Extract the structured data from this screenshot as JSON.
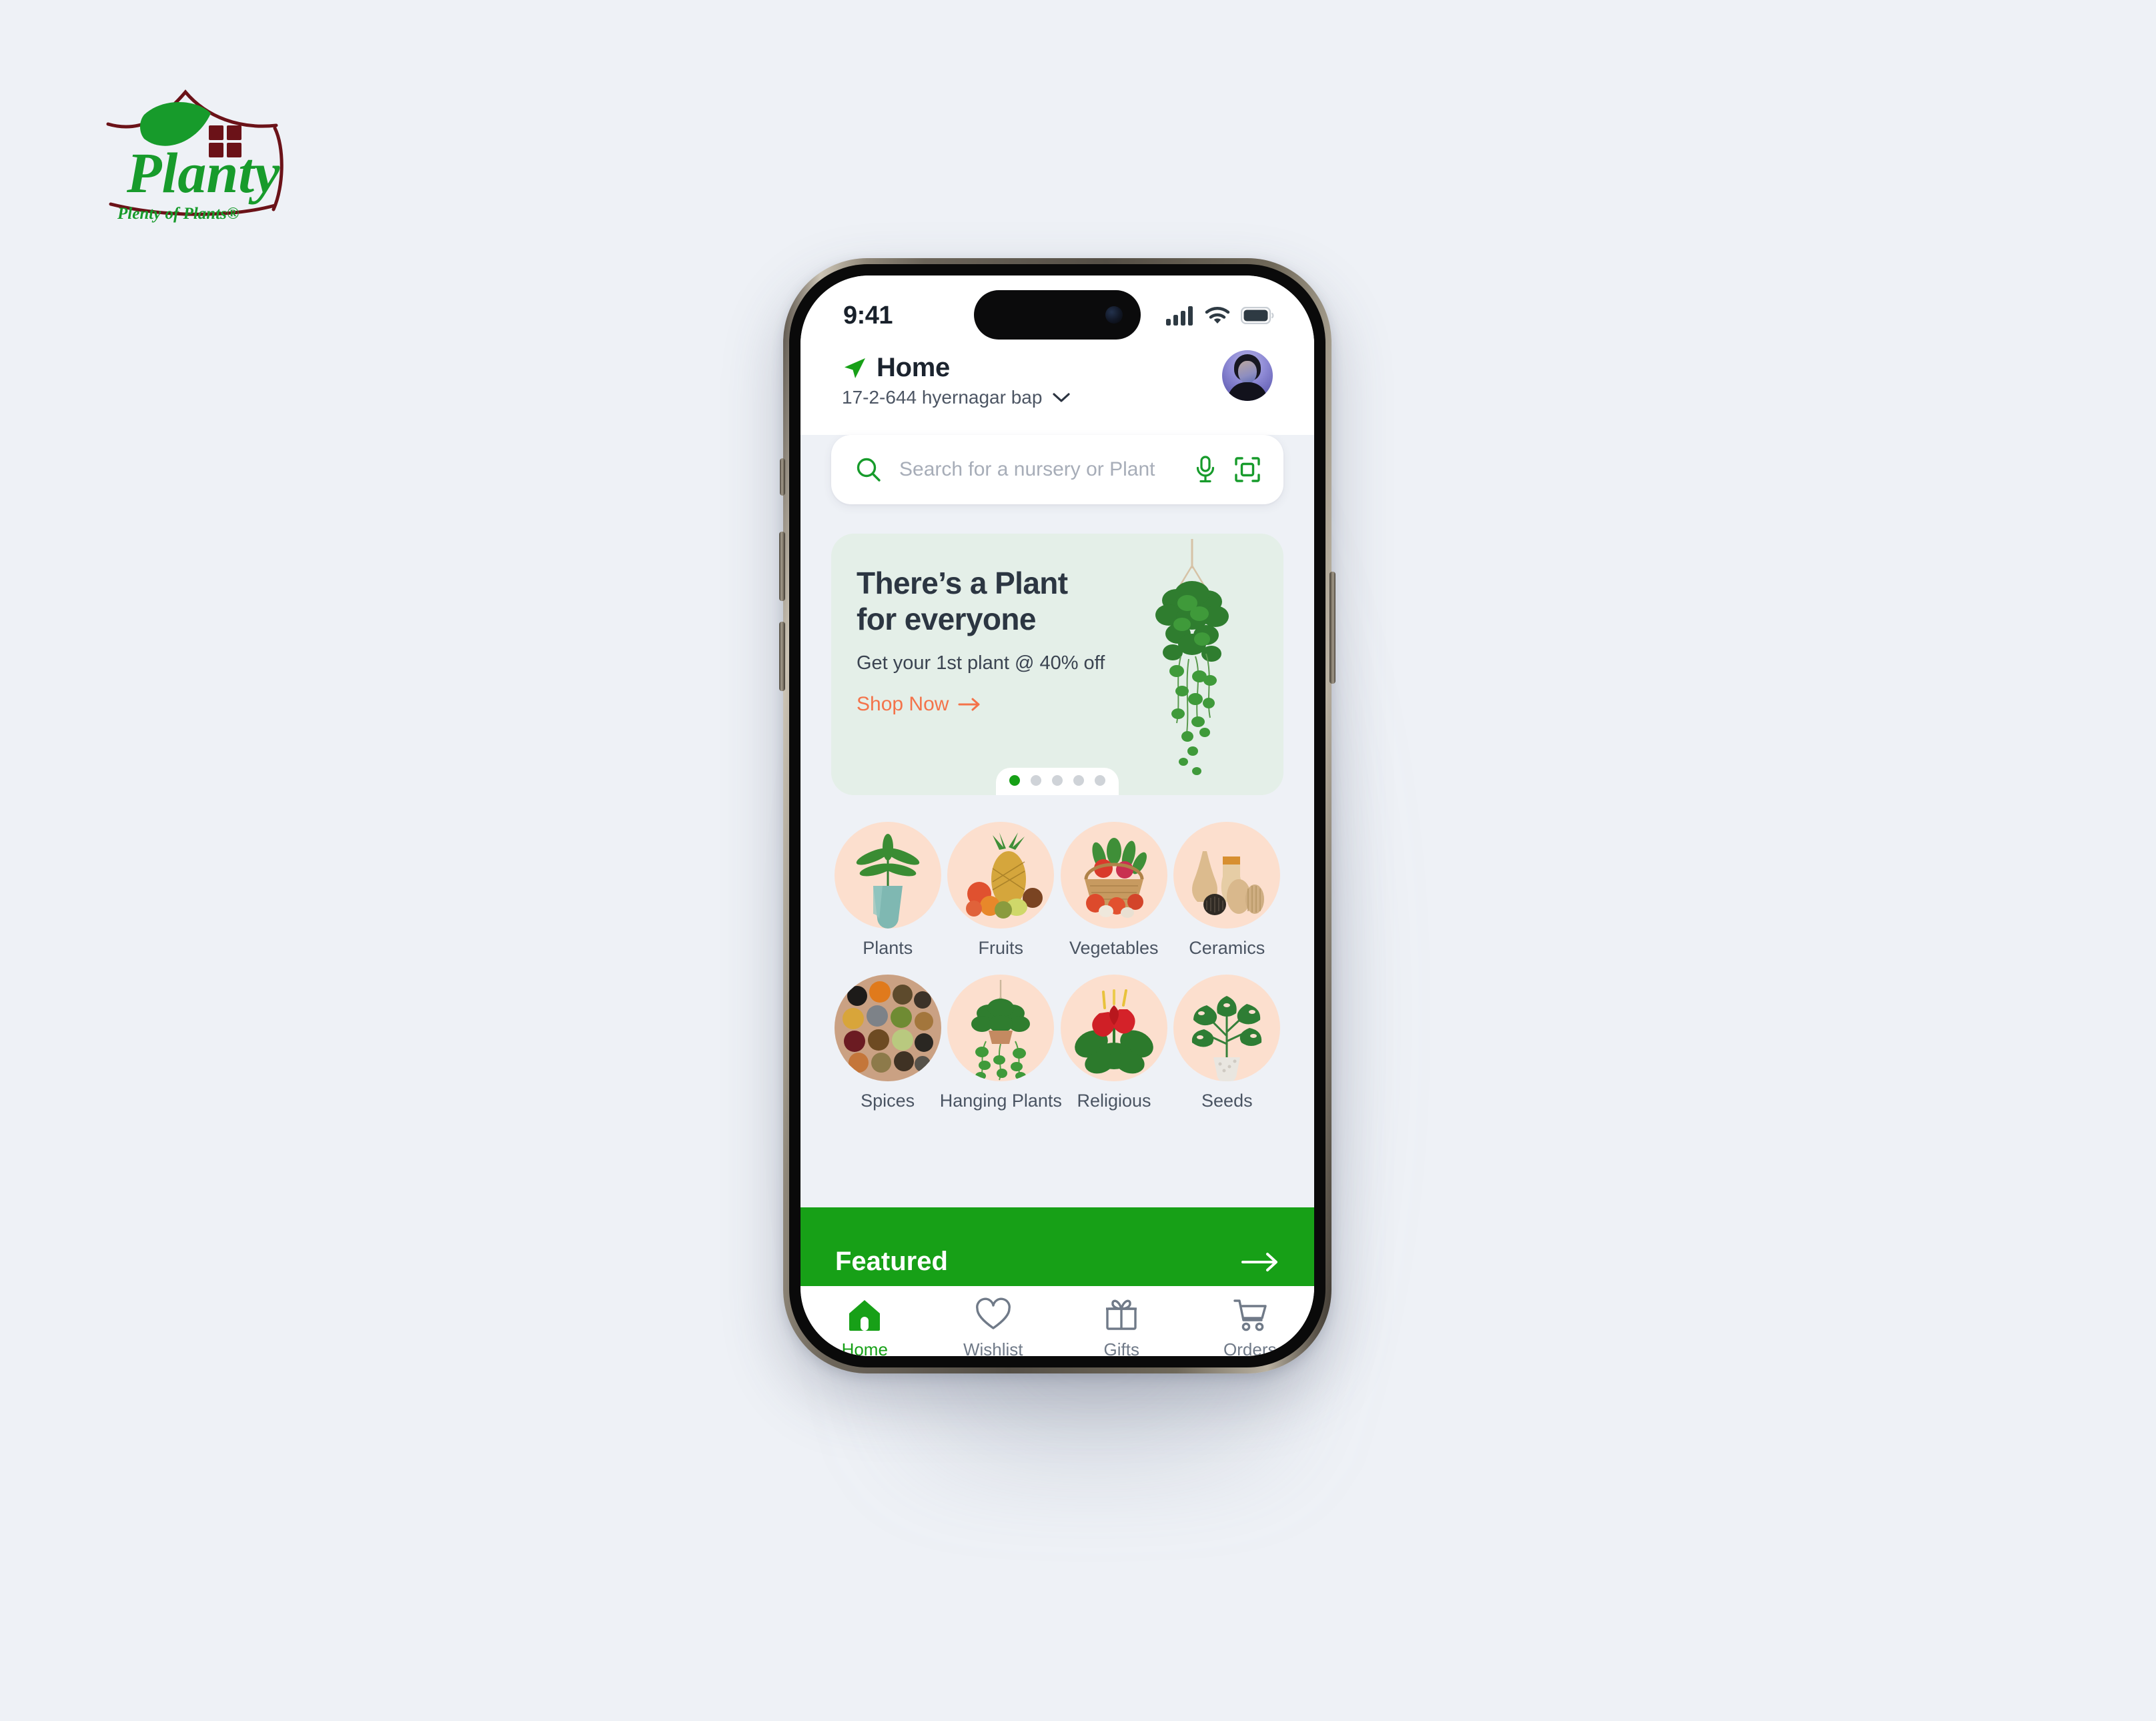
{
  "brand": {
    "name": "Planty",
    "tagline": "Plenty of Plants®"
  },
  "status_bar": {
    "time": "9:41",
    "signal_icon": "cellular-signal-icon",
    "wifi_icon": "wifi-icon",
    "battery_icon": "battery-full-icon"
  },
  "header": {
    "location_icon": "location-arrow-icon",
    "title": "Home",
    "address": "17-2-644 hyernagar bap",
    "chevron_icon": "chevron-down-icon",
    "avatar_alt": "user-avatar"
  },
  "search": {
    "placeholder": "Search for a nursery or Plant",
    "value": "",
    "search_icon": "search-icon",
    "mic_icon": "microphone-icon",
    "scan_icon": "scan-icon"
  },
  "hero": {
    "title_line1": "There’s a Plant",
    "title_line2": "for everyone",
    "subtitle": "Get your 1st plant @ 40% off",
    "cta_label": "Shop Now",
    "cta_arrow": "arrow-right-icon",
    "image_alt": "hanging-pothos-plant",
    "dots_total": 5,
    "dots_active_index": 0
  },
  "categories": [
    {
      "label": "Plants",
      "icon": "potted-plant-icon"
    },
    {
      "label": "Fruits",
      "icon": "fruits-icon"
    },
    {
      "label": "Vegetables",
      "icon": "vegetable-basket-icon"
    },
    {
      "label": "Ceramics",
      "icon": "ceramic-vases-icon"
    },
    {
      "label": "Spices",
      "icon": "spices-tray-icon"
    },
    {
      "label": "Hanging Plants",
      "icon": "hanging-plant-icon"
    },
    {
      "label": "Religious",
      "icon": "anthurium-flower-icon"
    },
    {
      "label": "Seeds",
      "icon": "monstera-plant-icon"
    }
  ],
  "featured": {
    "title": "Featured",
    "arrow_icon": "arrow-right-icon"
  },
  "bottom_nav": [
    {
      "label": "Home",
      "icon": "home-icon",
      "active": true
    },
    {
      "label": "Wishlist",
      "icon": "heart-icon",
      "active": false
    },
    {
      "label": "Gifts",
      "icon": "gift-icon",
      "active": false
    },
    {
      "label": "Orders",
      "icon": "shopping-cart-icon",
      "active": false
    }
  ],
  "colors": {
    "brand_green": "#17A017",
    "accent_orange": "#F4734A",
    "hero_bg": "#E4EFE8",
    "page_bg": "#EEF1F6",
    "category_circle": "#FCDFCE",
    "logo_green": "#179B2B",
    "logo_maroon": "#6B1218"
  }
}
